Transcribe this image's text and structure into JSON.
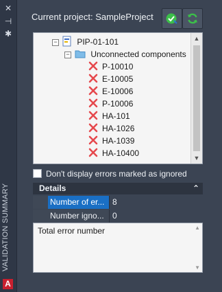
{
  "sidebar": {
    "title": "VALIDATION SUMMARY",
    "logo_letter": "A"
  },
  "header": {
    "current_project": "Current project: SampleProject"
  },
  "tree": {
    "root": "PIP-01-101",
    "group": "Unconnected components",
    "items": [
      "P-10010",
      "E-10005",
      "E-10006",
      "P-10006",
      "HA-101",
      "HA-1026",
      "HA-1039",
      "HA-10400"
    ]
  },
  "ignore_checkbox_label": "Don't display errors marked as ignored",
  "details": {
    "title": "Details",
    "properties": [
      {
        "name": "Number of er...",
        "value": "8"
      },
      {
        "name": "Number igno...",
        "value": "0"
      }
    ],
    "description": "Total error number"
  },
  "colors": {
    "background": "#3b4453",
    "selection": "#1a6fc4",
    "error_x": "#e5484d",
    "validate_green": "#3cbf4a"
  }
}
